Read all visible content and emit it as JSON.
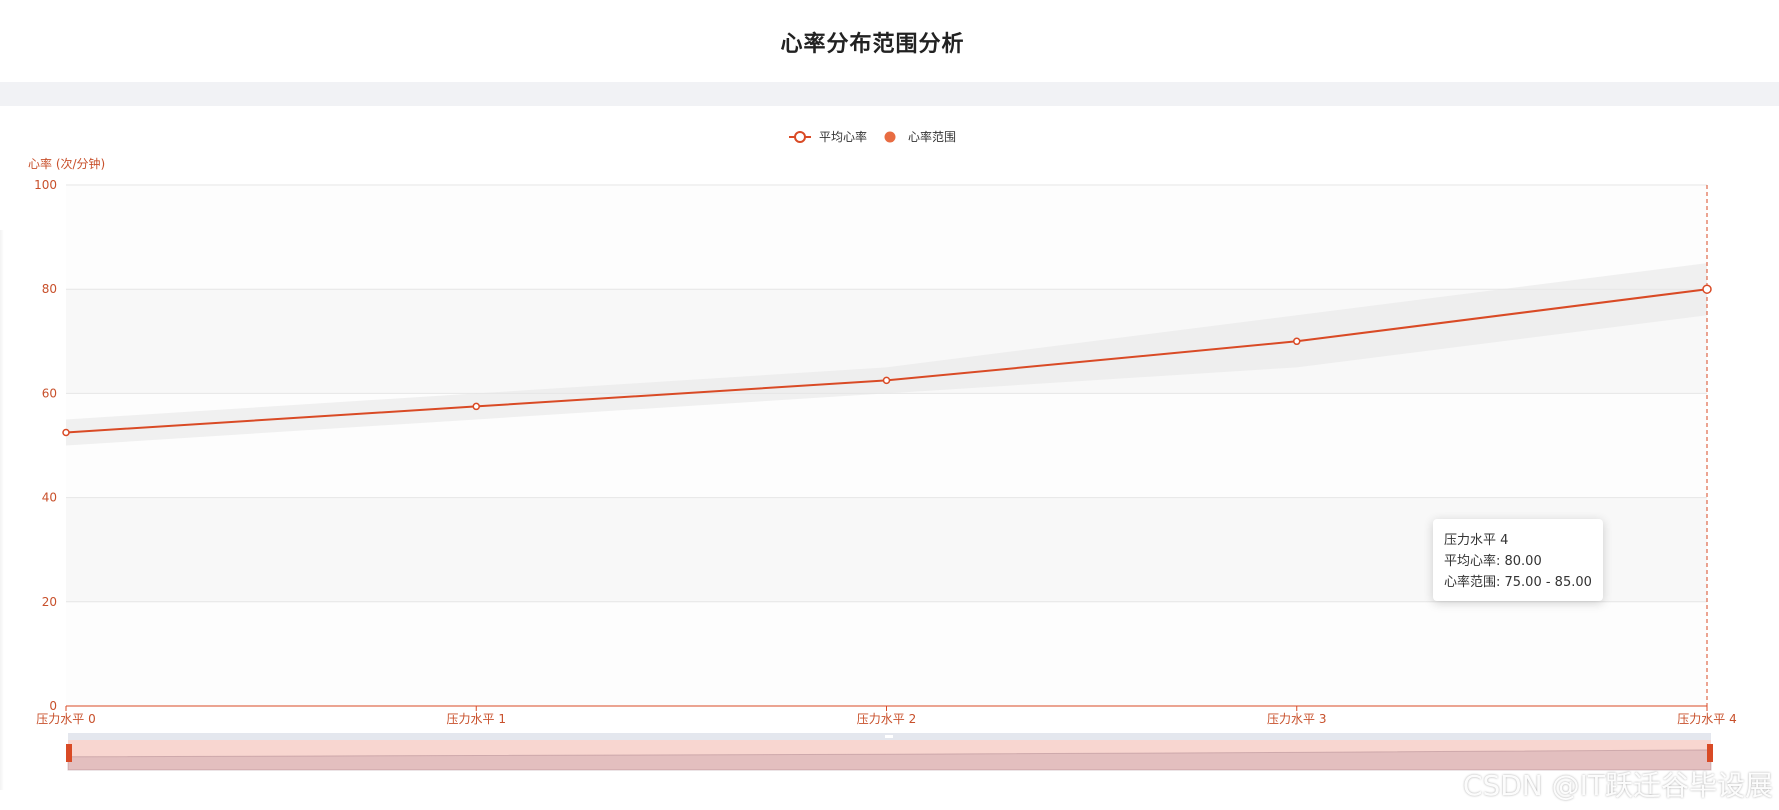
{
  "header": {
    "title": "心率分布范围分析"
  },
  "colors": {
    "accent": "#d94a25",
    "band": "#e6e6e6",
    "legend_range_dot": "#e86c42",
    "zoom_fill": "#f8d6d0"
  },
  "legend": {
    "avg_label": "平均心率",
    "range_label": "心率范围"
  },
  "tooltip": {
    "category": "压力水平 4",
    "avg_line": "平均心率: 80.00",
    "range_line": "心率范围: 75.00 - 85.00"
  },
  "watermark": "CSDN @IT跃迁谷毕设展",
  "chart_data": {
    "type": "line",
    "title": "心率分布范围分析",
    "xlabel": "",
    "ylabel": "心率 (次/分钟)",
    "ylim": [
      0,
      100
    ],
    "yticks": [
      "0",
      "20",
      "40",
      "60",
      "80",
      "100"
    ],
    "categories": [
      "压力水平 0",
      "压力水平 1",
      "压力水平 2",
      "压力水平 3",
      "压力水平 4"
    ],
    "series": [
      {
        "name": "平均心率",
        "values": [
          52.5,
          57.5,
          62.5,
          70.0,
          80.0
        ]
      },
      {
        "name": "心率范围",
        "type": "band",
        "lower": [
          50.0,
          55.0,
          60.0,
          65.0,
          75.0
        ],
        "upper": [
          55.0,
          60.0,
          65.0,
          75.0,
          85.0
        ]
      }
    ],
    "grid": true,
    "legend_position": "top-center",
    "highlighted_category": "压力水平 4"
  }
}
